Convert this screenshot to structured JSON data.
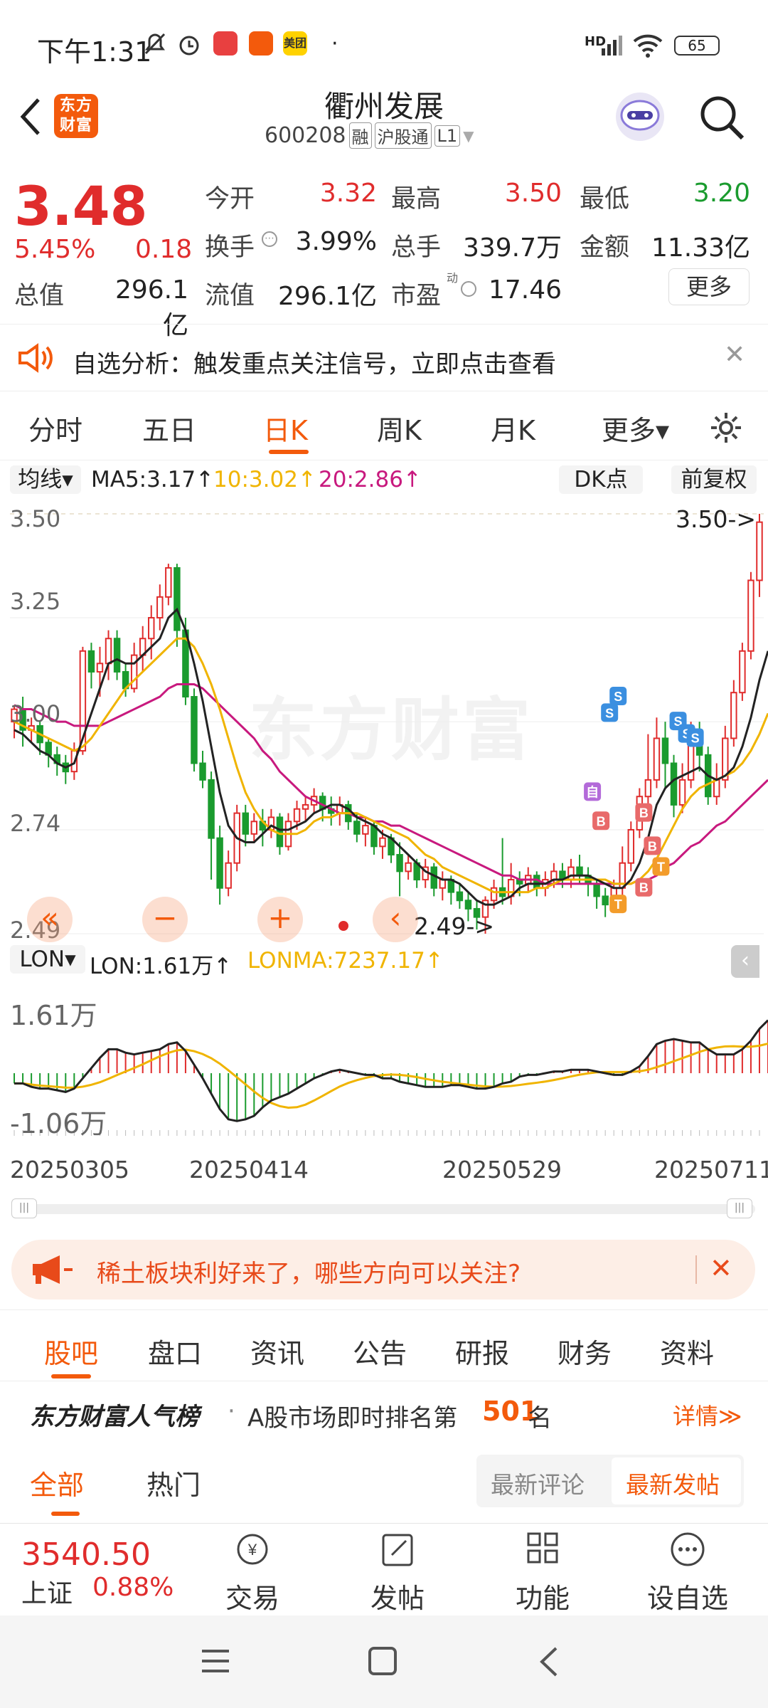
{
  "status_bar": {
    "time": "下午1:31",
    "battery": "65",
    "network": "HD",
    "app_badge": "美团"
  },
  "header": {
    "title": "衢州发展",
    "code": "600208",
    "tags": [
      "融",
      "沪股通",
      "L1"
    ],
    "logo_text": "东方财富",
    "back_icon": "back-arrow-icon",
    "search_icon": "search-icon"
  },
  "quote": {
    "price": "3.48",
    "change_pct": "5.45%",
    "change_abs": "0.18",
    "open_label": "今开",
    "open": "3.32",
    "high_label": "最高",
    "high": "3.50",
    "low_label": "最低",
    "low": "3.20",
    "turnover_label": "换手",
    "turnover": "3.99%",
    "volume_label": "总手",
    "volume": "339.7万",
    "amount_label": "金额",
    "amount": "11.33亿",
    "mktcap_label": "总值",
    "mktcap": "296.1亿",
    "float_label": "流值",
    "float_cap": "296.1亿",
    "pe_label": "市盈",
    "pe_sup": "动",
    "pe": "17.46",
    "more_label": "更多"
  },
  "banner1": {
    "text": "自选分析：触发重点关注信号，立即点击查看",
    "close": "✕"
  },
  "tabs": [
    {
      "label": "分时"
    },
    {
      "label": "五日"
    },
    {
      "label": "日K",
      "active": true
    },
    {
      "label": "周K"
    },
    {
      "label": "月K"
    },
    {
      "label": "更多▾"
    }
  ],
  "chart_header": {
    "ma_select": "均线▾",
    "ma5": "MA5:3.17↑",
    "ma10": "10:3.02↑",
    "ma20": "20:2.86↑",
    "dk": "DK点",
    "adjust": "前复权"
  },
  "price_axis": {
    "p1": "3.50",
    "p2": "3.25",
    "p3": "3.00",
    "p4": "2.74",
    "p5": "2.49"
  },
  "annotations": {
    "high": "3.50->",
    "low": "2.49->"
  },
  "signals": {
    "buy": "B",
    "sell": "S",
    "self": "自",
    "t": "T"
  },
  "watermark": "东方财富",
  "chart_controls": {
    "left": "«",
    "minus": "−",
    "plus": "+",
    "prev": "‹"
  },
  "indicator": {
    "name": "LON▾",
    "lon": "LON:1.61万↑",
    "lonma": "LONMA:7237.17↑",
    "max": "1.61万",
    "min": "-1.06万"
  },
  "dates": [
    "20250305",
    "20250414",
    "20250529",
    "20250711"
  ],
  "colors": {
    "up": "#e02c2c",
    "down": "#1a9b2e",
    "brand": "#f35a0c",
    "ma5": "#222222",
    "ma10": "#f0b400",
    "ma20": "#c8197e"
  },
  "chart_data": {
    "type": "candlestick",
    "ylim": [
      2.49,
      3.5
    ],
    "candles": [
      [
        3.0,
        3.03,
        2.96,
        3.04
      ],
      [
        3.03,
        2.98,
        2.94,
        3.06
      ],
      [
        2.98,
        2.99,
        2.95,
        3.01
      ],
      [
        2.99,
        2.95,
        2.92,
        3.0
      ],
      [
        2.95,
        2.92,
        2.89,
        2.96
      ],
      [
        2.92,
        2.9,
        2.87,
        2.94
      ],
      [
        2.9,
        2.88,
        2.85,
        2.92
      ],
      [
        2.88,
        2.93,
        2.86,
        2.95
      ],
      [
        2.93,
        3.17,
        2.92,
        3.18
      ],
      [
        3.17,
        3.12,
        3.08,
        3.19
      ],
      [
        3.12,
        3.14,
        3.06,
        3.18
      ],
      [
        3.14,
        3.2,
        3.1,
        3.22
      ],
      [
        3.2,
        3.12,
        3.1,
        3.22
      ],
      [
        3.12,
        3.08,
        3.06,
        3.14
      ],
      [
        3.08,
        3.16,
        3.07,
        3.19
      ],
      [
        3.16,
        3.2,
        3.12,
        3.23
      ],
      [
        3.2,
        3.25,
        3.15,
        3.28
      ],
      [
        3.25,
        3.3,
        3.22,
        3.33
      ],
      [
        3.3,
        3.37,
        3.28,
        3.38
      ],
      [
        3.37,
        3.22,
        3.18,
        3.38
      ],
      [
        3.22,
        3.06,
        3.04,
        3.25
      ],
      [
        3.06,
        2.9,
        2.88,
        3.08
      ],
      [
        2.9,
        2.86,
        2.84,
        2.93
      ],
      [
        2.86,
        2.72,
        2.62,
        2.88
      ],
      [
        2.72,
        2.6,
        2.56,
        2.75
      ],
      [
        2.6,
        2.66,
        2.58,
        2.69
      ],
      [
        2.66,
        2.78,
        2.64,
        2.8
      ],
      [
        2.78,
        2.73,
        2.7,
        2.8
      ],
      [
        2.73,
        2.76,
        2.71,
        2.78
      ],
      [
        2.76,
        2.74,
        2.7,
        2.79
      ],
      [
        2.74,
        2.77,
        2.72,
        2.79
      ],
      [
        2.77,
        2.7,
        2.68,
        2.78
      ],
      [
        2.7,
        2.76,
        2.69,
        2.78
      ],
      [
        2.76,
        2.79,
        2.74,
        2.81
      ],
      [
        2.79,
        2.8,
        2.76,
        2.82
      ],
      [
        2.8,
        2.82,
        2.78,
        2.84
      ],
      [
        2.82,
        2.79,
        2.76,
        2.83
      ],
      [
        2.79,
        2.78,
        2.75,
        2.82
      ],
      [
        2.78,
        2.8,
        2.75,
        2.82
      ],
      [
        2.8,
        2.76,
        2.74,
        2.81
      ],
      [
        2.76,
        2.73,
        2.71,
        2.78
      ],
      [
        2.73,
        2.75,
        2.7,
        2.77
      ],
      [
        2.75,
        2.7,
        2.68,
        2.76
      ],
      [
        2.7,
        2.72,
        2.67,
        2.74
      ],
      [
        2.72,
        2.68,
        2.66,
        2.73
      ],
      [
        2.68,
        2.64,
        2.58,
        2.71
      ],
      [
        2.64,
        2.66,
        2.62,
        2.68
      ],
      [
        2.66,
        2.62,
        2.6,
        2.67
      ],
      [
        2.62,
        2.65,
        2.6,
        2.67
      ],
      [
        2.65,
        2.6,
        2.58,
        2.66
      ],
      [
        2.6,
        2.62,
        2.57,
        2.64
      ],
      [
        2.62,
        2.59,
        2.56,
        2.63
      ],
      [
        2.59,
        2.57,
        2.55,
        2.61
      ],
      [
        2.57,
        2.55,
        2.52,
        2.59
      ],
      [
        2.55,
        2.53,
        2.5,
        2.57
      ],
      [
        2.53,
        2.57,
        2.49,
        2.58
      ],
      [
        2.57,
        2.6,
        2.55,
        2.62
      ],
      [
        2.6,
        2.58,
        2.56,
        2.72
      ],
      [
        2.58,
        2.62,
        2.56,
        2.66
      ],
      [
        2.62,
        2.61,
        2.58,
        2.64
      ],
      [
        2.61,
        2.63,
        2.59,
        2.65
      ],
      [
        2.63,
        2.6,
        2.58,
        2.64
      ],
      [
        2.6,
        2.62,
        2.58,
        2.64
      ],
      [
        2.62,
        2.64,
        2.6,
        2.66
      ],
      [
        2.64,
        2.62,
        2.6,
        2.66
      ],
      [
        2.62,
        2.65,
        2.6,
        2.67
      ],
      [
        2.65,
        2.63,
        2.61,
        2.68
      ],
      [
        2.63,
        2.61,
        2.58,
        2.65
      ],
      [
        2.61,
        2.58,
        2.55,
        2.62
      ],
      [
        2.58,
        2.56,
        2.53,
        2.6
      ],
      [
        2.56,
        2.6,
        2.55,
        2.62
      ],
      [
        2.6,
        2.66,
        2.58,
        2.7
      ],
      [
        2.66,
        2.74,
        2.64,
        2.76
      ],
      [
        2.74,
        2.82,
        2.72,
        2.84
      ],
      [
        2.82,
        2.86,
        2.78,
        2.97
      ],
      [
        2.86,
        2.96,
        2.84,
        3.01
      ],
      [
        2.96,
        2.9,
        2.84,
        3.0
      ],
      [
        2.9,
        2.8,
        2.77,
        2.92
      ],
      [
        2.8,
        2.86,
        2.78,
        2.9
      ],
      [
        2.86,
        2.98,
        2.84,
        3.0
      ],
      [
        2.98,
        2.92,
        2.88,
        3.0
      ],
      [
        2.92,
        2.82,
        2.8,
        2.94
      ],
      [
        2.82,
        2.86,
        2.8,
        2.9
      ],
      [
        2.86,
        2.96,
        2.84,
        2.99
      ],
      [
        2.96,
        3.07,
        2.94,
        3.1
      ],
      [
        3.07,
        3.17,
        3.05,
        3.19
      ],
      [
        3.17,
        3.34,
        3.15,
        3.36
      ],
      [
        3.34,
        3.48,
        3.3,
        3.5
      ]
    ],
    "ma5": [
      2.98,
      2.97,
      2.95,
      2.93,
      2.92,
      2.9,
      2.89,
      2.9,
      2.96,
      3.02,
      3.08,
      3.14,
      3.15,
      3.14,
      3.14,
      3.16,
      3.18,
      3.2,
      3.25,
      3.27,
      3.22,
      3.14,
      3.05,
      2.94,
      2.83,
      2.75,
      2.72,
      2.71,
      2.71,
      2.73,
      2.75,
      2.74,
      2.74,
      2.75,
      2.76,
      2.78,
      2.79,
      2.8,
      2.8,
      2.79,
      2.77,
      2.76,
      2.75,
      2.73,
      2.72,
      2.7,
      2.68,
      2.66,
      2.64,
      2.63,
      2.62,
      2.62,
      2.61,
      2.59,
      2.57,
      2.56,
      2.56,
      2.57,
      2.58,
      2.6,
      2.61,
      2.61,
      2.61,
      2.62,
      2.62,
      2.63,
      2.63,
      2.63,
      2.62,
      2.61,
      2.6,
      2.6,
      2.62,
      2.66,
      2.72,
      2.8,
      2.84,
      2.86,
      2.87,
      2.88,
      2.89,
      2.87,
      2.86,
      2.87,
      2.89,
      2.94,
      3.01,
      3.1,
      3.17
    ],
    "ma10": [
      3.0,
      2.99,
      2.98,
      2.97,
      2.96,
      2.95,
      2.94,
      2.93,
      2.94,
      2.96,
      2.99,
      3.02,
      3.05,
      3.08,
      3.1,
      3.12,
      3.14,
      3.16,
      3.18,
      3.2,
      3.2,
      3.18,
      3.14,
      3.09,
      3.03,
      2.96,
      2.89,
      2.83,
      2.79,
      2.76,
      2.74,
      2.73,
      2.73,
      2.73,
      2.74,
      2.76,
      2.77,
      2.77,
      2.78,
      2.78,
      2.78,
      2.77,
      2.76,
      2.75,
      2.74,
      2.73,
      2.72,
      2.7,
      2.68,
      2.67,
      2.65,
      2.64,
      2.63,
      2.62,
      2.61,
      2.6,
      2.59,
      2.59,
      2.59,
      2.59,
      2.59,
      2.6,
      2.6,
      2.61,
      2.62,
      2.62,
      2.62,
      2.62,
      2.62,
      2.62,
      2.61,
      2.61,
      2.61,
      2.62,
      2.64,
      2.67,
      2.71,
      2.75,
      2.79,
      2.82,
      2.84,
      2.85,
      2.86,
      2.87,
      2.88,
      2.9,
      2.93,
      2.97,
      3.02
    ],
    "ma20": [
      3.04,
      3.03,
      3.03,
      3.02,
      3.01,
      3.0,
      3.0,
      2.99,
      2.99,
      2.99,
      2.99,
      3.0,
      3.01,
      3.02,
      3.03,
      3.04,
      3.05,
      3.06,
      3.08,
      3.09,
      3.09,
      3.09,
      3.08,
      3.06,
      3.04,
      3.02,
      3.0,
      2.98,
      2.96,
      2.93,
      2.91,
      2.88,
      2.86,
      2.84,
      2.82,
      2.81,
      2.8,
      2.79,
      2.78,
      2.78,
      2.77,
      2.77,
      2.76,
      2.76,
      2.75,
      2.75,
      2.74,
      2.73,
      2.72,
      2.71,
      2.7,
      2.69,
      2.68,
      2.67,
      2.66,
      2.65,
      2.64,
      2.63,
      2.63,
      2.62,
      2.62,
      2.62,
      2.61,
      2.61,
      2.61,
      2.61,
      2.61,
      2.61,
      2.61,
      2.61,
      2.61,
      2.61,
      2.61,
      2.62,
      2.62,
      2.63,
      2.65,
      2.66,
      2.68,
      2.7,
      2.71,
      2.73,
      2.75,
      2.76,
      2.78,
      2.8,
      2.82,
      2.84,
      2.86
    ]
  },
  "banner2": {
    "text": "稀土板块利好来了，哪些方向可以关注?",
    "close": "✕"
  },
  "subtabs": [
    {
      "label": "股吧",
      "active": true
    },
    {
      "label": "盘口"
    },
    {
      "label": "资讯"
    },
    {
      "label": "公告"
    },
    {
      "label": "研报"
    },
    {
      "label": "财务"
    },
    {
      "label": "资料"
    }
  ],
  "rank": {
    "brand": "东方财富人气榜",
    "prefix": "A股市场即时排名第",
    "num": "501",
    "suffix": "名",
    "detail": "详情≫"
  },
  "filter": {
    "all": "全部",
    "hot": "热门",
    "latest_comment": "最新评论",
    "latest_post": "最新发帖"
  },
  "bottom_nav": {
    "index_value": "3540.50",
    "index_name": "上证",
    "index_change": "0.88%",
    "trade": "交易",
    "post": "发帖",
    "function": "功能",
    "add_fav": "设自选"
  }
}
